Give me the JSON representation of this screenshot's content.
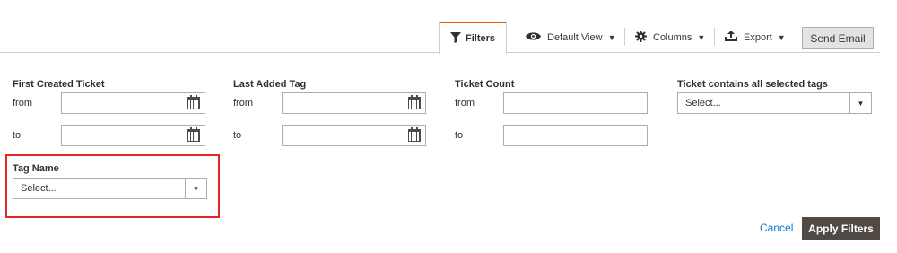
{
  "toolbar": {
    "filters_label": "Filters",
    "default_view_label": "Default View",
    "columns_label": "Columns",
    "export_label": "Export",
    "send_email_label": "Send Email"
  },
  "filters": {
    "first_created_ticket": {
      "title": "First Created Ticket",
      "from_label": "from",
      "to_label": "to"
    },
    "last_added_tag": {
      "title": "Last Added Tag",
      "from_label": "from",
      "to_label": "to"
    },
    "ticket_count": {
      "title": "Ticket Count",
      "from_label": "from",
      "to_label": "to"
    },
    "ticket_contains_all_tags": {
      "title": "Ticket contains all selected tags",
      "selected": "Select..."
    },
    "tag_name": {
      "title": "Tag Name",
      "selected": "Select..."
    }
  },
  "actions": {
    "cancel_label": "Cancel",
    "apply_label": "Apply Filters"
  },
  "colors": {
    "accent": "#eb5202",
    "highlight": "#e22626",
    "link": "#007bdb",
    "apply_bg": "#514943"
  }
}
